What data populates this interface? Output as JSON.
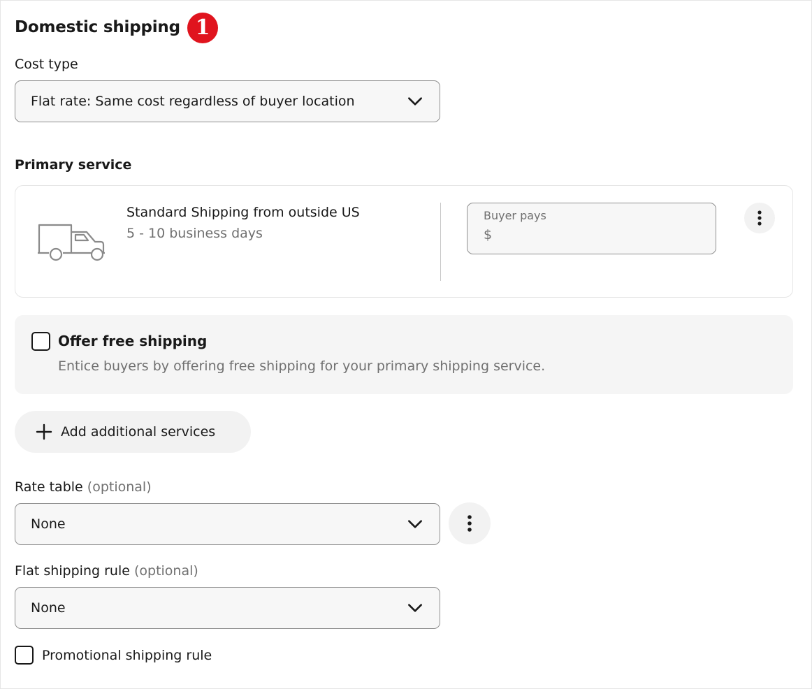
{
  "section": {
    "title": "Domestic shipping",
    "badge": "1"
  },
  "cost_type": {
    "label": "Cost type",
    "selected": "Flat rate: Same cost regardless of buyer location"
  },
  "primary_service": {
    "label": "Primary service",
    "service_name": "Standard Shipping from outside US",
    "delivery_time": "5 - 10 business days",
    "price": {
      "placeholder": "Buyer pays",
      "currency_symbol": "$",
      "value": ""
    },
    "icon": "truck-icon"
  },
  "free_shipping": {
    "label": "Offer free shipping",
    "description": "Entice buyers by offering free shipping for your primary shipping service.",
    "checked": false
  },
  "add_services": {
    "label": "Add additional services",
    "icon": "plus-icon"
  },
  "rate_table": {
    "label": "Rate table",
    "optional": "(optional)",
    "selected": "None"
  },
  "flat_rule": {
    "label": "Flat shipping rule",
    "optional": "(optional)",
    "selected": "None"
  },
  "promo_rule": {
    "label": "Promotional shipping rule",
    "checked": false
  },
  "colors": {
    "badge": "#e0141e",
    "text": "#191919",
    "muted": "#707070",
    "field_bg": "#f7f7f7",
    "panel_bg": "#f5f5f5"
  }
}
